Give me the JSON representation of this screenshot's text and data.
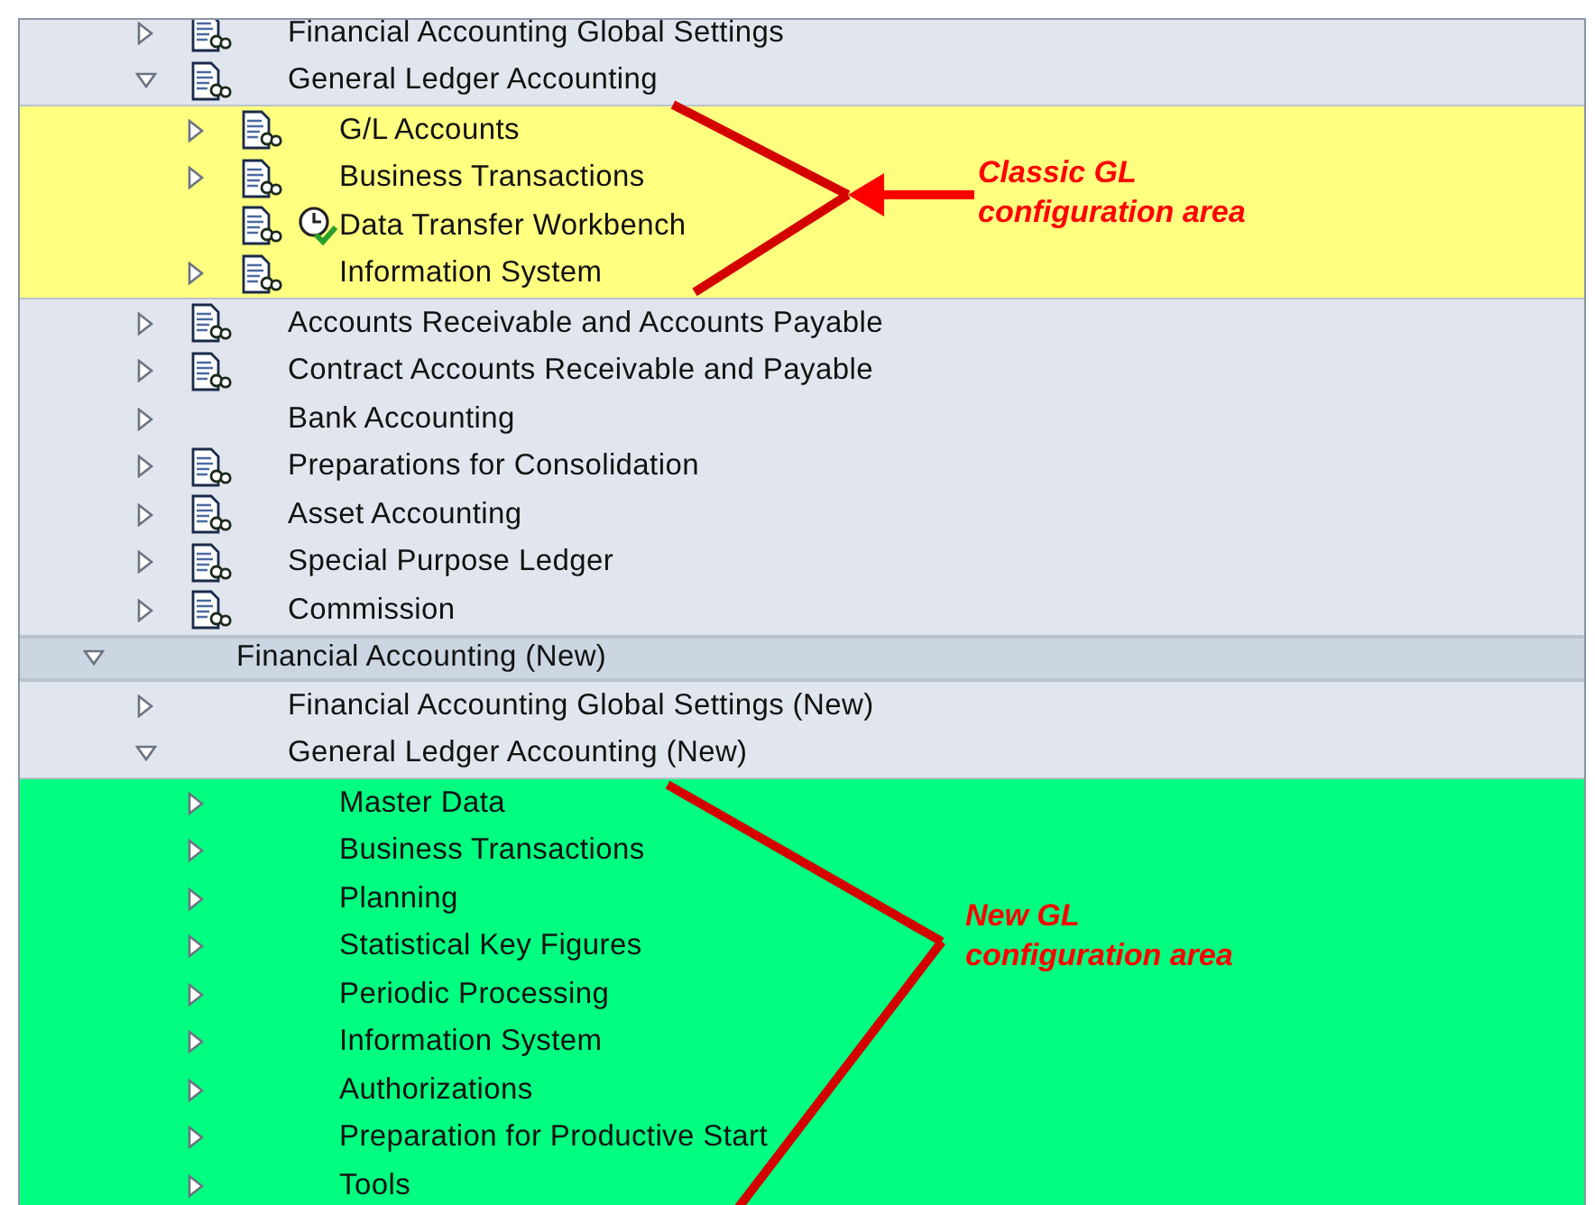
{
  "tree": [
    {
      "children": [
        {
          "label": "Financial Accounting Global Settings",
          "kind": "document",
          "expanded": false
        },
        {
          "label": "General Ledger Accounting",
          "kind": "document",
          "expanded": true,
          "color": "#ffff80",
          "children": [
            {
              "label": "G/L Accounts",
              "kind": "document",
              "expanded": false
            },
            {
              "label": "Business Transactions",
              "kind": "document",
              "expanded": false
            },
            {
              "label": "Data Transfer Workbench",
              "kind": "activity"
            },
            {
              "label": "Information System",
              "kind": "document",
              "expanded": false
            }
          ]
        },
        {
          "label": "Accounts Receivable and Accounts Payable",
          "kind": "document",
          "expanded": false
        },
        {
          "label": "Contract Accounts Receivable and Payable",
          "kind": "document",
          "expanded": false
        },
        {
          "label": "Bank Accounting",
          "kind": "plain",
          "expanded": false
        },
        {
          "label": "Preparations for Consolidation",
          "kind": "document",
          "expanded": false
        },
        {
          "label": "Asset Accounting",
          "kind": "document",
          "expanded": false
        },
        {
          "label": "Special Purpose Ledger",
          "kind": "document",
          "expanded": false
        },
        {
          "label": "Commission",
          "kind": "document",
          "expanded": false
        }
      ]
    },
    {
      "label": "Financial Accounting (New)",
      "kind": "plain",
      "expanded": true,
      "children": [
        {
          "label": "Financial Accounting Global Settings (New)",
          "kind": "plain",
          "expanded": false
        },
        {
          "label": "General Ledger Accounting (New)",
          "kind": "plain",
          "expanded": true,
          "color": "#00ff80",
          "children": [
            {
              "label": "Master Data",
              "kind": "plain",
              "expanded": false
            },
            {
              "label": "Business Transactions",
              "kind": "plain",
              "expanded": false
            },
            {
              "label": "Planning",
              "kind": "plain",
              "expanded": false
            },
            {
              "label": "Statistical Key Figures",
              "kind": "plain",
              "expanded": false
            },
            {
              "label": "Periodic Processing",
              "kind": "plain",
              "expanded": false
            },
            {
              "label": "Information System",
              "kind": "plain",
              "expanded": false
            },
            {
              "label": "Authorizations",
              "kind": "plain",
              "expanded": false
            },
            {
              "label": "Preparation for Productive Start",
              "kind": "plain",
              "expanded": false
            },
            {
              "label": "Tools",
              "kind": "plain",
              "expanded": false
            }
          ]
        }
      ]
    }
  ],
  "callouts": [
    {
      "text": "Classic GL\nconfiguration area"
    },
    {
      "text": "New GL\nconfiguration area"
    }
  ]
}
